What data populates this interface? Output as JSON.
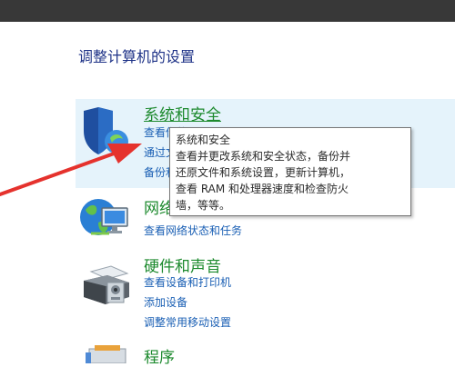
{
  "header": {
    "title": "调整计算机的设置"
  },
  "categories": [
    {
      "title": "系统和安全",
      "icon": "shield-icon",
      "links": [
        "查看你的",
        "通过文件",
        "备份和还"
      ]
    },
    {
      "title": "网络和",
      "icon": "network-globe-icon",
      "links": [
        "查看网络状态和任务"
      ]
    },
    {
      "title": "硬件和声音",
      "icon": "printer-icon",
      "links": [
        "查看设备和打印机",
        "添加设备",
        "调整常用移动设置"
      ]
    },
    {
      "title": "程序",
      "icon": "programs-icon",
      "links": []
    }
  ],
  "tooltip": {
    "lines": [
      "系统和安全",
      "查看并更改系统和安全状态，备份并",
      "还原文件和系统设置，更新计算机，",
      "查看 RAM 和处理器速度和检查防火",
      "墙，等等。"
    ]
  },
  "colors": {
    "titlebar": "#383838",
    "page_title": "#1e3287",
    "category_title": "#1d8a2e",
    "link": "#1a5fb4",
    "highlight": "#e5f3fb",
    "annotation_arrow": "#e5322d"
  }
}
